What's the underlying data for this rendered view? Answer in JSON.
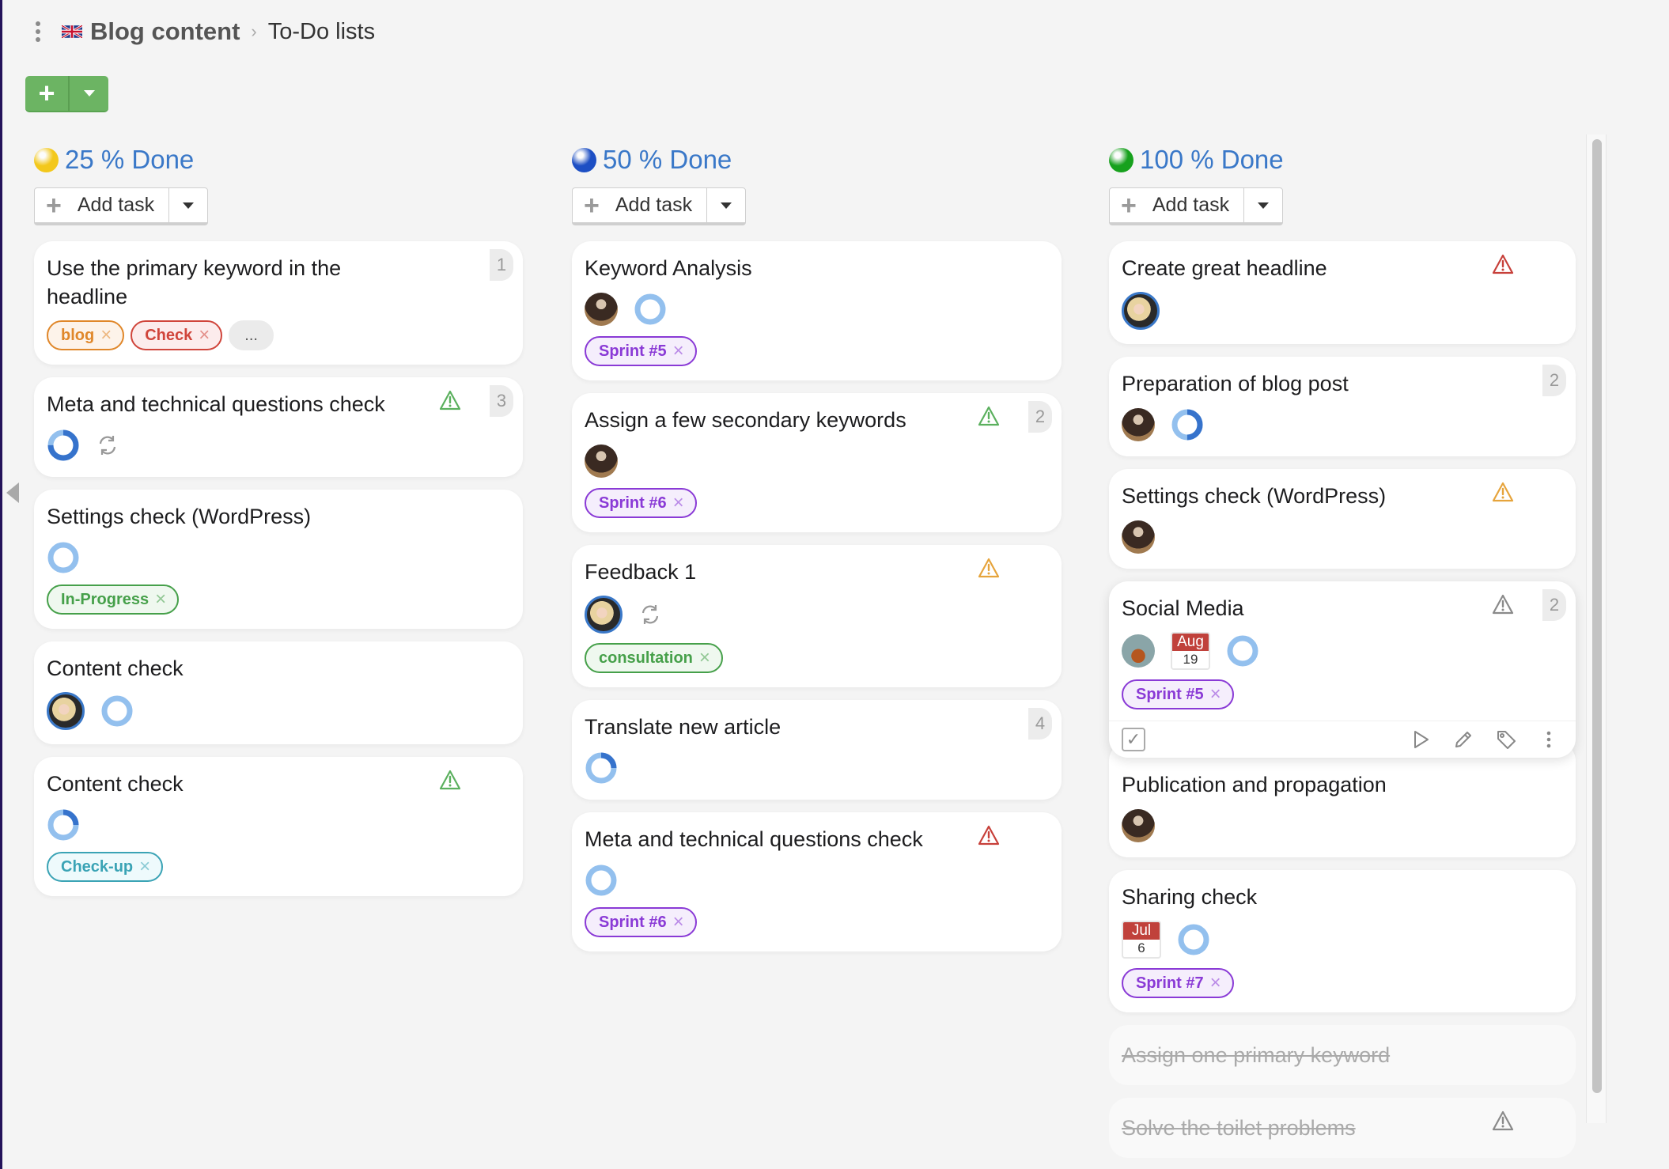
{
  "breadcrumb": {
    "project": "Blog content",
    "page": "To-Do lists",
    "flag": "uk-flag-icon"
  },
  "toolbar": {
    "add_icon": "plus-icon",
    "dropdown_icon": "caret-down-icon"
  },
  "columns": [
    {
      "title": "25 % Done",
      "dot_color": "#f3c81b",
      "add_task_label": "Add task",
      "cards": [
        {
          "title": "Use the primary keyword in the headline",
          "count": "1",
          "tags": [
            {
              "label": "blog",
              "color": "orange"
            },
            {
              "label": "Check",
              "color": "red"
            }
          ],
          "more": "..."
        },
        {
          "title": "Meta and technical questions check",
          "count": "3",
          "warning": "green",
          "progress": 0.75,
          "recurring": true
        },
        {
          "title": "Settings check (WordPress)",
          "progress": 0,
          "tags": [
            {
              "label": "In-Progress",
              "color": "green"
            }
          ]
        },
        {
          "title": "Content check",
          "avatar": "woman",
          "progress": 0
        },
        {
          "title": "Content check",
          "warning": "green",
          "progress": 0.25,
          "tags": [
            {
              "label": "Check-up",
              "color": "teal"
            }
          ]
        }
      ]
    },
    {
      "title": "50 % Done",
      "dot_color": "#1d4fc4",
      "add_task_label": "Add task",
      "cards": [
        {
          "title": "Keyword Analysis",
          "avatar": "man",
          "progress": 0,
          "tags": [
            {
              "label": "Sprint #5",
              "color": "purple"
            }
          ]
        },
        {
          "title": "Assign a few secondary keywords",
          "count": "2",
          "warning": "green",
          "avatar": "man",
          "tags": [
            {
              "label": "Sprint #6",
              "color": "purple"
            }
          ]
        },
        {
          "title": "Feedback 1",
          "warning": "orange",
          "avatar": "woman",
          "recurring": true,
          "tags": [
            {
              "label": "consultation",
              "color": "green"
            }
          ]
        },
        {
          "title": "Translate new article",
          "count": "4",
          "progress": 0.25
        },
        {
          "title": "Meta and technical questions check",
          "warning": "red",
          "progress": 0,
          "tags": [
            {
              "label": "Sprint #6",
              "color": "purple"
            }
          ]
        }
      ]
    },
    {
      "title": "100 % Done",
      "dot_color": "#17a11d",
      "add_task_label": "Add task",
      "cards": [
        {
          "title": "Create great headline",
          "warning": "red",
          "avatar": "woman"
        },
        {
          "title": "Preparation of blog post",
          "count": "2",
          "avatar": "man",
          "progress": 0.5
        },
        {
          "title": "Settings check (WordPress)",
          "warning": "orange",
          "avatar": "man"
        },
        {
          "title": "Social Media",
          "count": "2",
          "warning": "gray",
          "avatar": "curly",
          "due": {
            "month": "Aug",
            "day": "19"
          },
          "progress": 0,
          "tags": [
            {
              "label": "Sprint #5",
              "color": "purple"
            }
          ],
          "hovered": true
        },
        {
          "title": "Publication and propagation",
          "avatar": "man"
        },
        {
          "title": "Sharing check",
          "due": {
            "month": "Jul",
            "day": "6"
          },
          "progress": 0,
          "tags": [
            {
              "label": "Sprint #7",
              "color": "purple"
            }
          ]
        },
        {
          "title": "Assign one primary keyword",
          "done": true
        },
        {
          "title": "Solve the toilet problems",
          "done": true,
          "warning": "gray"
        }
      ]
    }
  ],
  "hover_toolbar": {
    "icons": [
      "checkbox-icon",
      "play-icon",
      "pencil-icon",
      "tag-icon",
      "more-vertical-icon"
    ]
  },
  "colors": {
    "accent": "#3a78c8",
    "green_button": "#6cb463",
    "warning_red": "#c7403a",
    "warning_orange": "#e6a43c",
    "warning_green": "#5bb05e",
    "warning_gray": "#8a8a8a",
    "ring_light": "#93c0ee",
    "ring_dark": "#3673cc"
  }
}
